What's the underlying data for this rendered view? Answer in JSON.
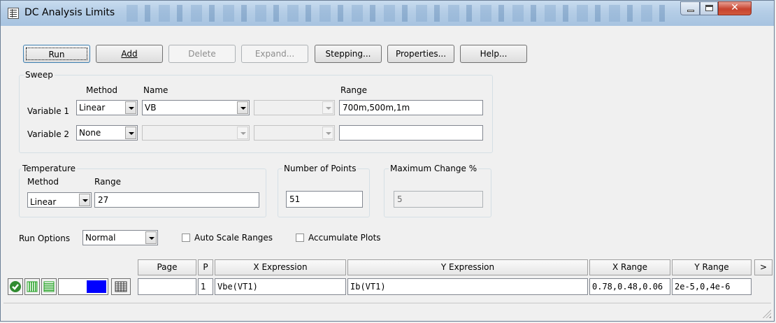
{
  "window": {
    "title": "DC Analysis Limits"
  },
  "toolbar": {
    "run": "Run",
    "add": "Add",
    "delete": "Delete",
    "expand": "Expand...",
    "stepping": "Stepping...",
    "properties": "Properties...",
    "help": "Help..."
  },
  "sweep": {
    "label": "Sweep",
    "col_method": "Method",
    "col_name": "Name",
    "col_range": "Range",
    "var1": {
      "label": "Variable 1",
      "method": "Linear",
      "name": "VB",
      "range": "700m,500m,1m"
    },
    "var2": {
      "label": "Variable 2",
      "method": "None",
      "name": "",
      "range": ""
    }
  },
  "temperature": {
    "label": "Temperature",
    "col_method": "Method",
    "col_range": "Range",
    "method": "Linear",
    "range": "27"
  },
  "points": {
    "label": "Number of Points",
    "value": "51"
  },
  "maxchange": {
    "label": "Maximum Change %",
    "value": "5"
  },
  "options": {
    "run_options_label": "Run Options",
    "run_options_value": "Normal",
    "auto_scale": "Auto Scale Ranges",
    "accumulate": "Accumulate Plots"
  },
  "table": {
    "headers": {
      "page": "Page",
      "p": "P",
      "x_expr": "X Expression",
      "y_expr": "Y Expression",
      "x_range": "X Range",
      "y_range": "Y Range",
      "more": ">"
    },
    "row": {
      "page": "",
      "p": "1",
      "x_expr": "Vbe(VT1)",
      "y_expr": "Ib(VT1)",
      "x_range": "0.78,0.48,0.06",
      "y_range": "2e-5,0,4e-6"
    }
  },
  "icons": {
    "check": "check-circle-icon",
    "grid_v": "vertical-grid-icon",
    "grid_h": "horizontal-grid-icon",
    "color": "color-swatch-icon",
    "table": "table-icon"
  },
  "colors": {
    "check_green": "#2f8a2f",
    "grid_green": "#1e9e1e",
    "swatch_blue": "#0000ff",
    "title_bar": "#b4cde6",
    "close_red": "#c7432f"
  }
}
